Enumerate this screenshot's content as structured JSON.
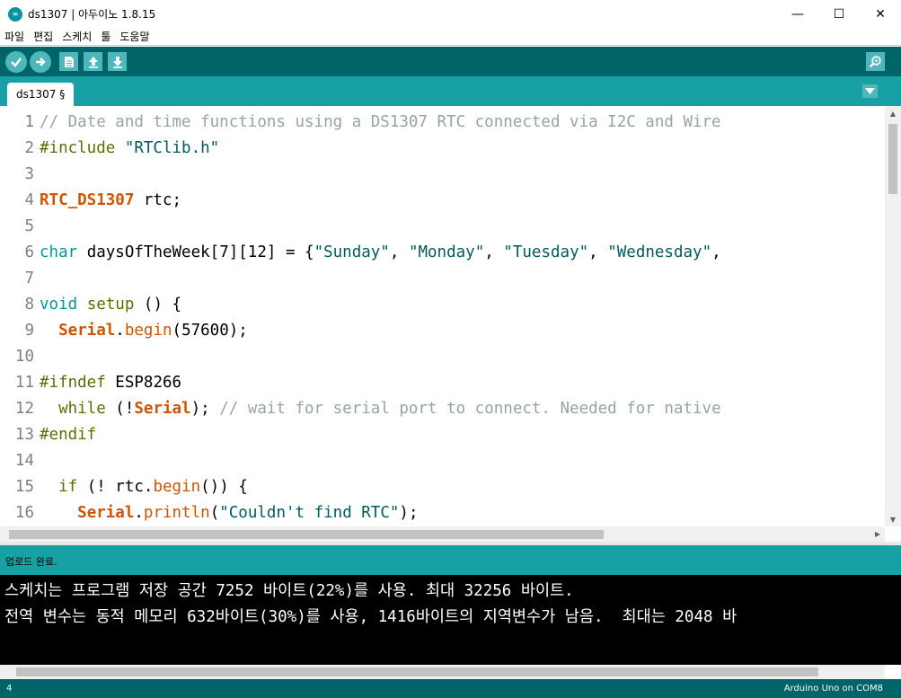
{
  "window": {
    "title": "ds1307 | 아두이노 1.8.15",
    "logo_text": "∞",
    "controls": {
      "minimize": "—",
      "maximize": "☐",
      "close": "✕"
    }
  },
  "menu": [
    "파일",
    "편집",
    "스케치",
    "툴",
    "도움말"
  ],
  "toolbar": {
    "icons": [
      "verify-icon",
      "upload-icon",
      "new-icon",
      "open-icon",
      "save-icon",
      "serial-monitor-icon"
    ]
  },
  "tab": {
    "label": "ds1307 §"
  },
  "editor": {
    "line_numbers": [
      "1",
      "2",
      "3",
      "4",
      "5",
      "6",
      "7",
      "8",
      "9",
      "10",
      "11",
      "12",
      "13",
      "14",
      "15",
      "16"
    ],
    "lines": [
      [
        {
          "c": "c-comment",
          "t": "// Date and time functions using a DS1307 RTC connected via I2C and Wire"
        }
      ],
      [
        {
          "c": "c-pre",
          "t": "#include "
        },
        {
          "c": "c-string",
          "t": "\"RTClib.h\""
        }
      ],
      [],
      [
        {
          "c": "c-class",
          "t": "RTC_DS1307"
        },
        {
          "c": "",
          "t": " rtc;"
        }
      ],
      [],
      [
        {
          "c": "c-type",
          "t": "char"
        },
        {
          "c": "",
          "t": " daysOfTheWeek[7][12] = {"
        },
        {
          "c": "c-string",
          "t": "\"Sunday\""
        },
        {
          "c": "",
          "t": ", "
        },
        {
          "c": "c-string",
          "t": "\"Monday\""
        },
        {
          "c": "",
          "t": ", "
        },
        {
          "c": "c-string",
          "t": "\"Tuesday\""
        },
        {
          "c": "",
          "t": ", "
        },
        {
          "c": "c-string",
          "t": "\"Wednesday\""
        },
        {
          "c": "",
          "t": ", "
        }
      ],
      [],
      [
        {
          "c": "c-type",
          "t": "void"
        },
        {
          "c": "",
          "t": " "
        },
        {
          "c": "c-kw",
          "t": "setup"
        },
        {
          "c": "",
          "t": " () {"
        }
      ],
      [
        {
          "c": "",
          "t": "  "
        },
        {
          "c": "c-class",
          "t": "Serial"
        },
        {
          "c": "",
          "t": "."
        },
        {
          "c": "c-func",
          "t": "begin"
        },
        {
          "c": "",
          "t": "(57600);"
        }
      ],
      [],
      [
        {
          "c": "c-pre",
          "t": "#ifndef"
        },
        {
          "c": "",
          "t": " ESP8266"
        }
      ],
      [
        {
          "c": "",
          "t": "  "
        },
        {
          "c": "c-kw",
          "t": "while"
        },
        {
          "c": "",
          "t": " (!"
        },
        {
          "c": "c-class",
          "t": "Serial"
        },
        {
          "c": "",
          "t": "); "
        },
        {
          "c": "c-comment",
          "t": "// wait for serial port to connect. Needed for native"
        }
      ],
      [
        {
          "c": "c-pre",
          "t": "#endif"
        }
      ],
      [],
      [
        {
          "c": "",
          "t": "  "
        },
        {
          "c": "c-kw",
          "t": "if"
        },
        {
          "c": "",
          "t": " (! rtc."
        },
        {
          "c": "c-func",
          "t": "begin"
        },
        {
          "c": "",
          "t": "()) {"
        }
      ],
      [
        {
          "c": "",
          "t": "    "
        },
        {
          "c": "c-class",
          "t": "Serial"
        },
        {
          "c": "",
          "t": "."
        },
        {
          "c": "c-func",
          "t": "println"
        },
        {
          "c": "",
          "t": "("
        },
        {
          "c": "c-string",
          "t": "\"Couldn't find RTC\""
        },
        {
          "c": "",
          "t": ");"
        }
      ]
    ]
  },
  "status": {
    "message": "업로드 완료."
  },
  "console": {
    "lines": [
      "스케치는 프로그램 저장 공간 7252 바이트(22%)를 사용. 최대 32256 바이트.",
      "전역 변수는 동적 메모리 632바이트(30%)를 사용, 1416바이트의 지역변수가 남음.  최대는 2048 바"
    ]
  },
  "footer": {
    "line": "4",
    "board": "Arduino Uno on COM8"
  },
  "colors": {
    "teal_dark": "#006468",
    "teal": "#17a1a5",
    "icon": "#4db7bb"
  }
}
